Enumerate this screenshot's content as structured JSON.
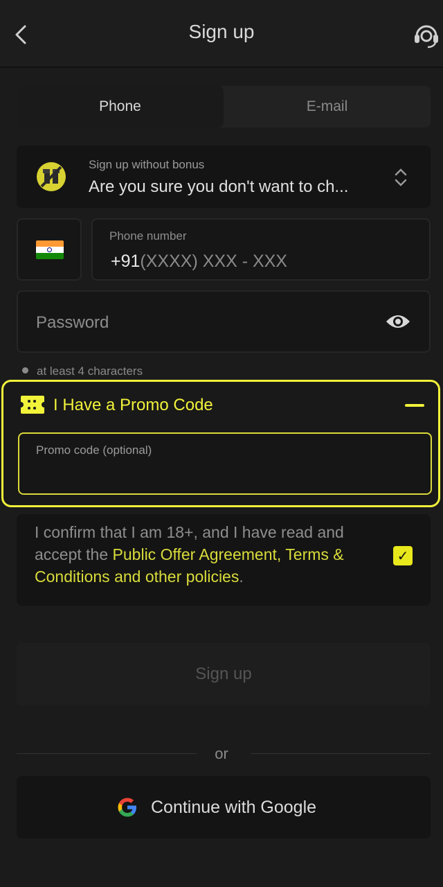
{
  "header": {
    "title": "Sign up",
    "back_icon": "chevron-left-icon",
    "support_icon": "headset-support-icon"
  },
  "tabs": [
    {
      "label": "Phone",
      "active": true
    },
    {
      "label": "E-mail",
      "active": false
    }
  ],
  "bonus": {
    "label": "Sign up without bonus",
    "value": "Are you sure you don't want to ch..."
  },
  "phone": {
    "country_flag": "india-flag",
    "label": "Phone number",
    "prefix": "+91",
    "mask": "(XXXX) XXX - XXX"
  },
  "password": {
    "placeholder": "Password",
    "hint": "at least 4 characters"
  },
  "promo": {
    "title": "I Have a Promo Code",
    "input_label": "Promo code (optional)",
    "expanded": true
  },
  "terms": {
    "text_before": "I confirm that I am 18+, and I have read and accept the ",
    "link1": "Public Offer Agreement,",
    "link2": "Terms & Conditions and other policies",
    "text_after": ".",
    "checked": true,
    "check_mark": "✓"
  },
  "actions": {
    "signup_label": "Sign up",
    "or_label": "or",
    "google_label": "Continue with Google"
  },
  "colors": {
    "accent": "#f1f23a",
    "background": "#1b1b1b",
    "field": "#141414"
  }
}
